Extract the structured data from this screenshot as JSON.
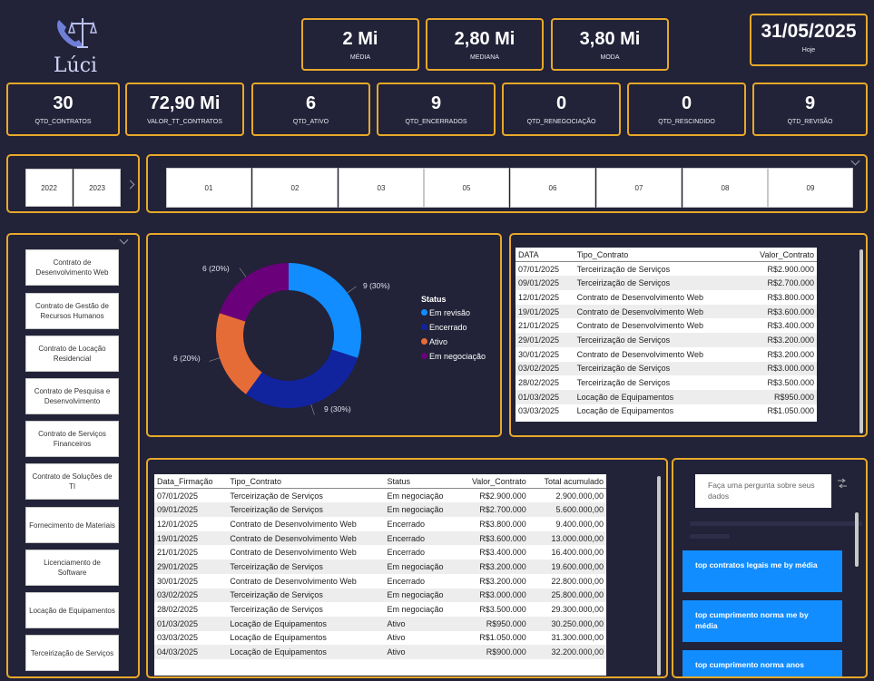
{
  "logo": {
    "name": "Lúci"
  },
  "top_kpis": [
    {
      "value": "2 Mi",
      "label": "MÉDIA"
    },
    {
      "value": "2,80 Mi",
      "label": "MEDIANA"
    },
    {
      "value": "3,80 Mi",
      "label": "MODA"
    },
    {
      "value": "31/05/2025",
      "label": "Hoje"
    }
  ],
  "kpis": [
    {
      "value": "30",
      "label": "QTD_CONTRATOS"
    },
    {
      "value": "72,90 Mi",
      "label": "VALOR_TT_CONTRATOS"
    },
    {
      "value": "6",
      "label": "QTD_ATIVO"
    },
    {
      "value": "9",
      "label": "QTD_ENCERRADOS"
    },
    {
      "value": "0",
      "label": "QTD_RENEGOCIAÇÃO"
    },
    {
      "value": "0",
      "label": "QTD_RESCINDIDO"
    },
    {
      "value": "9",
      "label": "QTD_REVISÃO"
    }
  ],
  "years": [
    "2022",
    "2023"
  ],
  "months": [
    "01",
    "02",
    "03",
    "05",
    "06",
    "07",
    "08",
    "09"
  ],
  "contract_types": [
    "Contrato de Desenvolvimento Web",
    "Contrato de Gestão de Recursos Humanos",
    "Contrato de Locação Residencial",
    "Contrato de Pesquisa e Desenvolvimento",
    "Contrato de Serviços Financeiros",
    "Contrato de Soluções de TI",
    "Fornecimento de Materiais",
    "Licenciamento de Software",
    "Locação de Equipamentos",
    "Terceirização de Serviços"
  ],
  "chart_data": {
    "type": "pie",
    "variant": "donut",
    "legend_title": "Status",
    "legend_position": "right",
    "slices": [
      {
        "name": "Em revisão",
        "value": 9,
        "label": "9 (30%)",
        "color": "#118dff"
      },
      {
        "name": "Encerrado",
        "value": 9,
        "label": "9 (30%)",
        "color": "#12239e"
      },
      {
        "name": "Ativo",
        "value": 6,
        "label": "6 (20%)",
        "color": "#e66c37"
      },
      {
        "name": "Em negociação",
        "value": 6,
        "label": "6 (20%)",
        "color": "#6b007b"
      }
    ]
  },
  "table1": {
    "headers": [
      "DATA",
      "Tipo_Contrato",
      "Valor_Contrato"
    ],
    "rows": [
      [
        "07/01/2025",
        "Terceirização de Serviços",
        "R$2.900.000"
      ],
      [
        "09/01/2025",
        "Terceirização de Serviços",
        "R$2.700.000"
      ],
      [
        "12/01/2025",
        "Contrato de Desenvolvimento Web",
        "R$3.800.000"
      ],
      [
        "19/01/2025",
        "Contrato de Desenvolvimento Web",
        "R$3.600.000"
      ],
      [
        "21/01/2025",
        "Contrato de Desenvolvimento Web",
        "R$3.400.000"
      ],
      [
        "29/01/2025",
        "Terceirização de Serviços",
        "R$3.200.000"
      ],
      [
        "30/01/2025",
        "Contrato de Desenvolvimento Web",
        "R$3.200.000"
      ],
      [
        "03/02/2025",
        "Terceirização de Serviços",
        "R$3.000.000"
      ],
      [
        "28/02/2025",
        "Terceirização de Serviços",
        "R$3.500.000"
      ],
      [
        "01/03/2025",
        "Locação de Equipamentos",
        "R$950.000"
      ],
      [
        "03/03/2025",
        "Locação de Equipamentos",
        "R$1.050.000"
      ]
    ]
  },
  "table2": {
    "headers": [
      "Data_Firmação",
      "Tipo_Contrato",
      "Status",
      "Valor_Contrato",
      "Total acumulado"
    ],
    "rows": [
      [
        "07/01/2025",
        "Terceirização de Serviços",
        "Em negociação",
        "R$2.900.000",
        "2.900.000,00"
      ],
      [
        "09/01/2025",
        "Terceirização de Serviços",
        "Em negociação",
        "R$2.700.000",
        "5.600.000,00"
      ],
      [
        "12/01/2025",
        "Contrato de Desenvolvimento Web",
        "Encerrado",
        "R$3.800.000",
        "9.400.000,00"
      ],
      [
        "19/01/2025",
        "Contrato de Desenvolvimento Web",
        "Encerrado",
        "R$3.600.000",
        "13.000.000,00"
      ],
      [
        "21/01/2025",
        "Contrato de Desenvolvimento Web",
        "Encerrado",
        "R$3.400.000",
        "16.400.000,00"
      ],
      [
        "29/01/2025",
        "Terceirização de Serviços",
        "Em negociação",
        "R$3.200.000",
        "19.600.000,00"
      ],
      [
        "30/01/2025",
        "Contrato de Desenvolvimento Web",
        "Encerrado",
        "R$3.200.000",
        "22.800.000,00"
      ],
      [
        "03/02/2025",
        "Terceirização de Serviços",
        "Em negociação",
        "R$3.000.000",
        "25.800.000,00"
      ],
      [
        "28/02/2025",
        "Terceirização de Serviços",
        "Em negociação",
        "R$3.500.000",
        "29.300.000,00"
      ],
      [
        "01/03/2025",
        "Locação de Equipamentos",
        "Ativo",
        "R$950.000",
        "30.250.000,00"
      ],
      [
        "03/03/2025",
        "Locação de Equipamentos",
        "Ativo",
        "R$1.050.000",
        "31.300.000,00"
      ],
      [
        "04/03/2025",
        "Locação de Equipamentos",
        "Ativo",
        "R$900.000",
        "32.200.000,00"
      ]
    ]
  },
  "qa": {
    "placeholder": "Faça uma pergunta sobre seus dados",
    "suggestions": [
      "top contratos legais me by média",
      "top cumprimento norma me by média",
      "top cumprimento norma anos"
    ]
  }
}
